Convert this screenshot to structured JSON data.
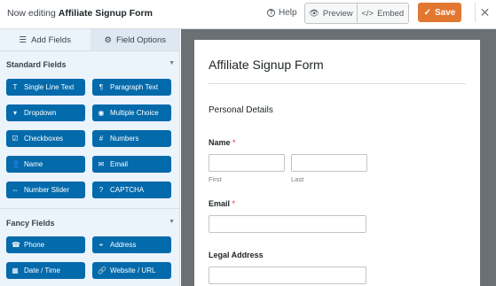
{
  "header": {
    "prefix": "Now editing",
    "form_name": "Affiliate Signup Form",
    "help_label": "Help",
    "preview_label": "Preview",
    "embed_label": "Embed",
    "save_label": "Save"
  },
  "tabs": [
    {
      "label": "Add Fields",
      "icon": "list-icon",
      "active": true
    },
    {
      "label": "Field Options",
      "icon": "sliders-icon",
      "active": false
    }
  ],
  "standard": {
    "title": "Standard Fields",
    "items": [
      {
        "label": "Single Line Text",
        "icon": "T"
      },
      {
        "label": "Paragraph Text",
        "icon": "¶"
      },
      {
        "label": "Dropdown",
        "icon": "▾"
      },
      {
        "label": "Multiple Choice",
        "icon": "◉"
      },
      {
        "label": "Checkboxes",
        "icon": "☑"
      },
      {
        "label": "Numbers",
        "icon": "#"
      },
      {
        "label": "Name",
        "icon": "👤"
      },
      {
        "label": "Email",
        "icon": "✉"
      },
      {
        "label": "Number Slider",
        "icon": "⇔"
      },
      {
        "label": "CAPTCHA",
        "icon": "?"
      }
    ]
  },
  "fancy": {
    "title": "Fancy Fields",
    "items": [
      {
        "label": "Phone",
        "icon": "☎"
      },
      {
        "label": "Address",
        "icon": "⌖"
      },
      {
        "label": "Date / Time",
        "icon": "▦"
      },
      {
        "label": "Website / URL",
        "icon": "🔗"
      }
    ]
  },
  "preview": {
    "title": "Affiliate Signup Form",
    "section": "Personal Details",
    "name_label": "Name",
    "required_mark": "*",
    "first_sub": "First",
    "last_sub": "Last",
    "email_label": "Email",
    "address_label": "Legal Address"
  },
  "colors": {
    "accent": "#e27730",
    "field_button": "#036aab",
    "panel_bg": "#ebf3fb",
    "preview_bg": "#6b7075"
  }
}
